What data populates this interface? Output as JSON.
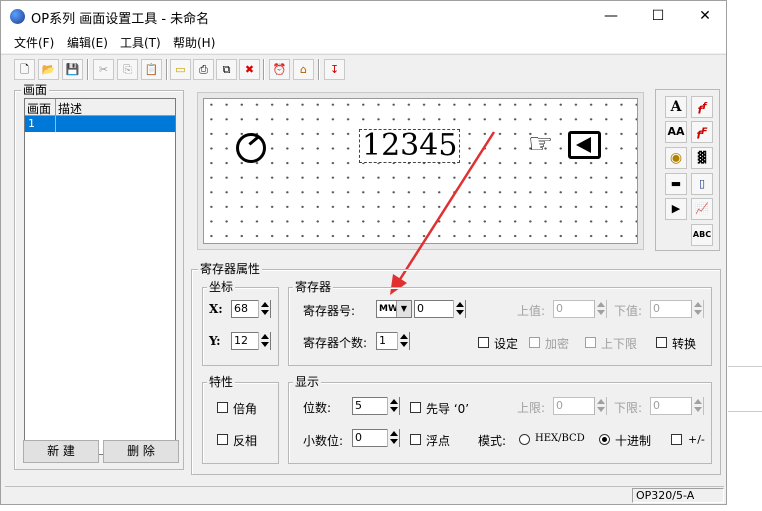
{
  "window": {
    "title": "OP系列 画面设置工具 - 未命名"
  },
  "menu": [
    "文件(F)",
    "编辑(E)",
    "工具(T)",
    "帮助(H)"
  ],
  "toolbar": {
    "icons": [
      "new-icon",
      "open-icon",
      "save-icon",
      "cut-icon",
      "copy-icon",
      "paste-icon",
      "screen-icon",
      "printer-icon",
      "copy-screen-icon",
      "delete-icon",
      "alarm-clock-icon",
      "home-icon",
      "download-icon"
    ]
  },
  "screens": {
    "group_label": "画面",
    "columns": [
      "画面",
      "描述"
    ],
    "rows": [
      {
        "id": "1",
        "desc": ""
      }
    ],
    "new_button": "新  建",
    "delete_button": "删  除"
  },
  "canvas": {
    "numeric_display": "12345"
  },
  "palette": {
    "icons": [
      "text-A-icon",
      "font-f-icon",
      "text-AA-icon",
      "font-f-red-icon",
      "target-icon",
      "grid-pattern-icon",
      "bar-display-icon",
      "level-icon",
      "play-button-icon",
      "trend-chart-icon",
      "abc-label-icon"
    ],
    "abc_label": "ABC"
  },
  "register_props": {
    "title": "寄存器属性",
    "coords": {
      "label": "坐标",
      "x_label": "X:",
      "x_value": "68",
      "y_label": "Y:",
      "y_value": "12"
    },
    "register": {
      "label": "寄存器",
      "number_label": "寄存器号:",
      "type_value": "MW",
      "number_value": "0",
      "count_label": "寄存器个数:",
      "count_value": "1",
      "upper_label": "上值:",
      "upper_value": "0",
      "lower_label": "下值:",
      "lower_value": "0",
      "checks": [
        {
          "label": "设定",
          "checked": false,
          "enabled": true
        },
        {
          "label": "加密",
          "checked": false,
          "enabled": false
        },
        {
          "label": "上下限",
          "checked": false,
          "enabled": false
        },
        {
          "label": "转换",
          "checked": false,
          "enabled": true
        }
      ]
    },
    "feature": {
      "label": "特性",
      "checks": [
        {
          "label": "倍角",
          "checked": false
        },
        {
          "label": "反相",
          "checked": false
        }
      ]
    },
    "display": {
      "label": "显示",
      "digits_label": "位数:",
      "digits_value": "5",
      "leading_zero_label": "先导 ‘0’",
      "upper_limit_label": "上限:",
      "upper_limit_value": "0",
      "lower_limit_label": "下限:",
      "lower_limit_value": "0",
      "decimals_label": "小数位:",
      "decimals_value": "0",
      "float_label": "浮点",
      "mode_label": "模式:",
      "mode_hex": "HEX/BCD",
      "mode_dec": "十进制",
      "mode_selected": "十进制",
      "sign_label": "+/-"
    }
  },
  "status": {
    "model": "OP320/5-A"
  },
  "colors": {
    "selection": "#0078d7",
    "arrow": "#e03030",
    "window_bg": "#f0f0f0"
  }
}
